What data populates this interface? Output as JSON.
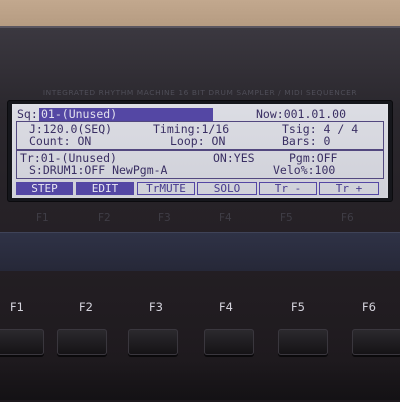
{
  "device": {
    "brand_line": "INTEGRATED RHYTHM MACHINE  16 BIT DRUM SAMPLER / MIDI SEQUENCER"
  },
  "lcd": {
    "seq_label": "Sq:",
    "seq_value": "01-(Unused)",
    "now": "Now:001.01.00",
    "tempo": "J:120.0(SEQ)",
    "timing": "Timing:1/16",
    "tsig": "Tsig: 4 / 4",
    "count": "Count: ON",
    "loop": "Loop: ON",
    "bars": "Bars:  0",
    "track": "Tr:01-(Unused)",
    "on": "ON:YES",
    "pgm": "Pgm:OFF",
    "sound": "S:DRUM1:OFF NewPgm-A",
    "velo": "Velo%:100",
    "softkeys": [
      "STEP",
      "EDIT",
      "TrMUTE",
      "SOLO",
      "Tr -",
      "Tr +"
    ]
  },
  "faint_labels": [
    "F1",
    "F2",
    "F3",
    "F4",
    "F5",
    "F6"
  ],
  "function_keys": [
    "F1",
    "F2",
    "F3",
    "F4",
    "F5",
    "F6"
  ]
}
